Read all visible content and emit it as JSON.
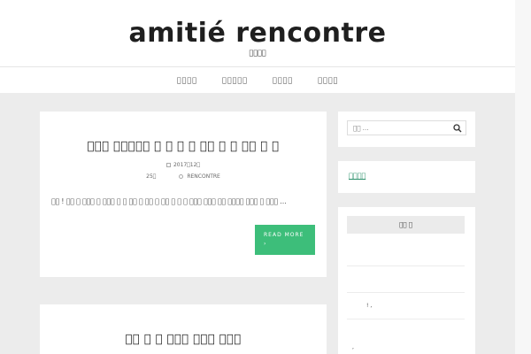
{
  "header": {
    "site_title": "amitié rencontre",
    "tagline": "\u0000\u0000\u0000\u0000"
  },
  "nav": {
    "items": [
      "\u0000\u0000\u0000\u0000",
      "\u0000\u0000\u0000\u0000\u0000",
      "\u0000\u0000\u0000\u0000",
      "\u0000\u0000\u0000\u0000"
    ]
  },
  "posts": [
    {
      "title": "\u0000\u0000\u0000 \u0000\u0000\u0000\u0000\u0000 \u0000 \u0000 \u0000 \u0000 \u0000\u0000 \u0000 \u0000 \u0000\u0000 \u0000 \u0000",
      "date": "2017\u000012\u0000",
      "day": "25\u0000",
      "author": "RENCONTRE",
      "excerpt": "\u0000\u0000 ! \u0000\u0000 \u0000 \u0000\u0000\u0000 \u0000 \u0000\u0000\u0000 \u0000 \u0000 \u0000\u0000 \u0000 \u0000\u0000 \u0000 \u0000\u0000 \u0000 \u0000 \u0000 \u0000\u0000\u0000 \u0000\u0000\u0000 \u0000\u0000 \u0000\u0000\u0000\u0000 \u0000\u0000\u0000 \u0000 \u0000\u0000\u0000 …",
      "read_more": "READ MORE",
      "read_more_arrow": "›"
    },
    {
      "title": "\u0000\u0000 \u0000 \u0000 \u0000\u0000\u0000 \u0000\u0000\u0000 \u0000\u0000\u0000"
    }
  ],
  "sidebar": {
    "search_placeholder": "\u0000\u0000 …",
    "link_label": "\u0000\u0000\u0000\u0000",
    "tab_label": "\u0000\u0000 \u0000",
    "tab_snippet_1": "! ,",
    "tab_snippet_2": ","
  },
  "colors": {
    "accent": "#3dbe7a",
    "link": "#2a8f6a",
    "background": "#ececec"
  },
  "icons": [
    "calendar-icon",
    "user-icon",
    "search-icon"
  ]
}
